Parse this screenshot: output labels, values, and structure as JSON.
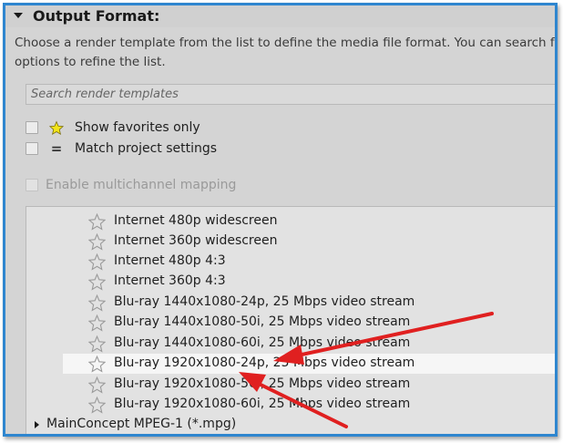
{
  "section": {
    "title": "Output Format:",
    "description_line1": "Choose a render template from the list to define the media file format. You can search for",
    "description_line2": "options to refine the list."
  },
  "search": {
    "placeholder": "Search render templates",
    "value": ""
  },
  "options": [
    {
      "label": "Show favorites only",
      "icon": "star-filled-icon",
      "checked": false,
      "enabled": true
    },
    {
      "label": "Match project settings",
      "icon": "equals-icon",
      "checked": false,
      "enabled": true
    },
    {
      "label": "Enable multichannel mapping",
      "checked": false,
      "enabled": false
    }
  ],
  "templates": [
    {
      "label": "Internet 480p widescreen",
      "selected": false
    },
    {
      "label": "Internet 360p widescreen",
      "selected": false
    },
    {
      "label": "Internet 480p 4:3",
      "selected": false
    },
    {
      "label": "Internet 360p 4:3",
      "selected": false
    },
    {
      "label": "Blu-ray 1440x1080-24p, 25 Mbps video stream",
      "selected": false
    },
    {
      "label": "Blu-ray 1440x1080-50i, 25 Mbps video stream",
      "selected": false
    },
    {
      "label": "Blu-ray 1440x1080-60i, 25 Mbps video stream",
      "selected": false
    },
    {
      "label": "Blu-ray 1920x1080-24p, 25 Mbps video stream",
      "selected": true
    },
    {
      "label": "Blu-ray 1920x1080-50i, 25 Mbps video stream",
      "selected": false
    },
    {
      "label": "Blu-ray 1920x1080-60i, 25 Mbps video stream",
      "selected": false
    }
  ],
  "next_group": {
    "label": "MainConcept MPEG-1 (*.mpg)",
    "expanded": false
  },
  "colors": {
    "frame_border": "#2f86cf",
    "annotation_arrow": "#e02020",
    "star_outline": "#9a9a9a",
    "star_filled": "#f2e41a"
  }
}
